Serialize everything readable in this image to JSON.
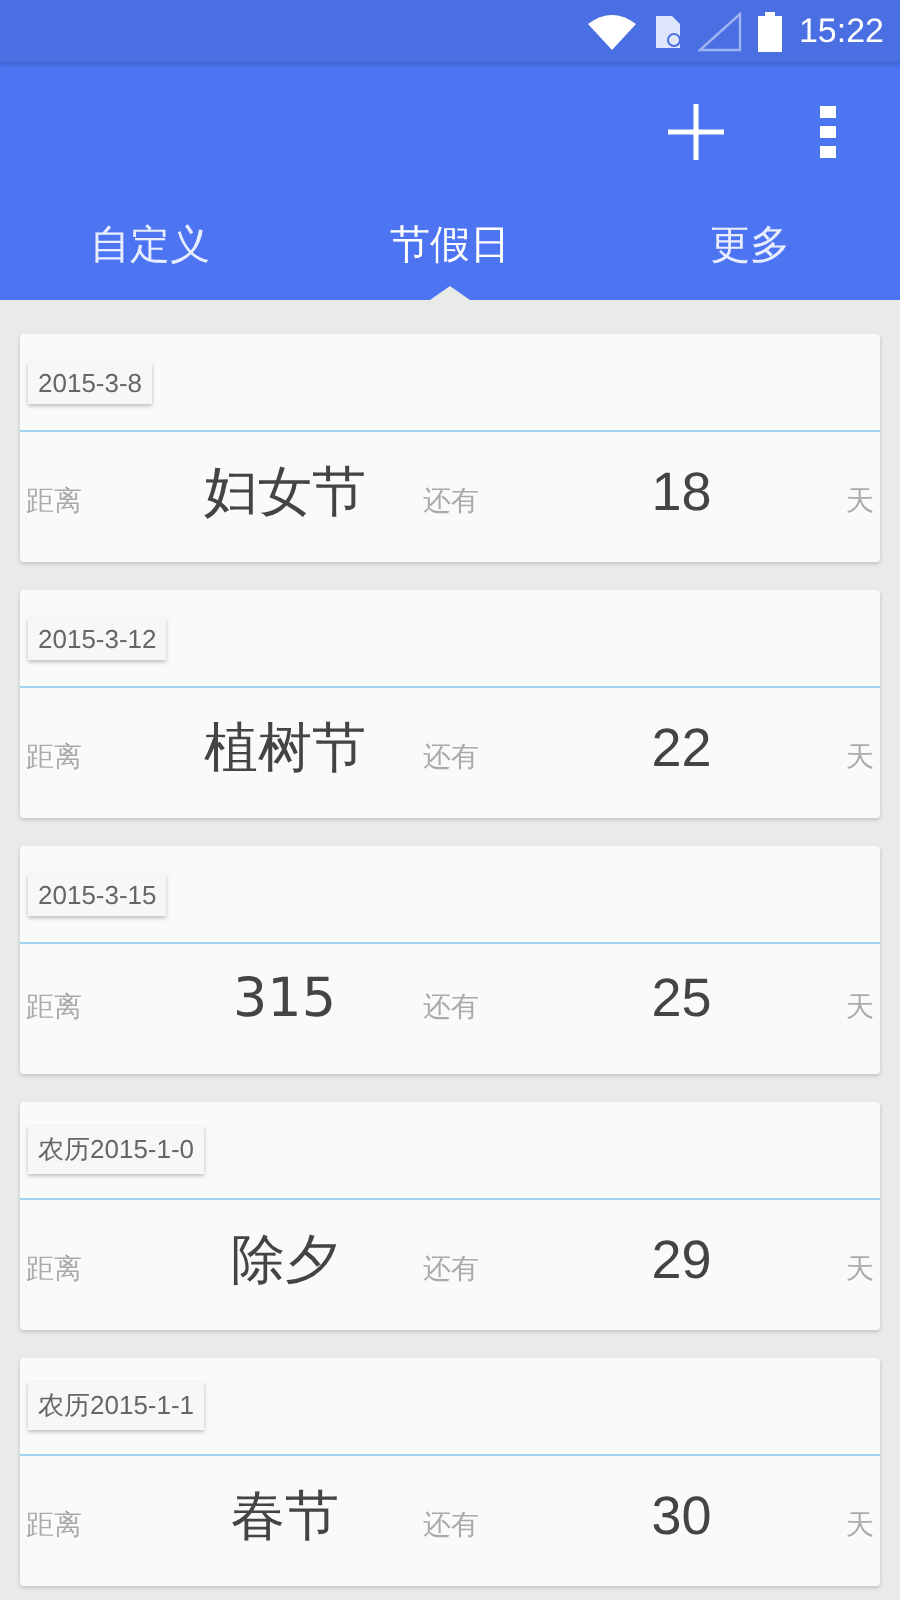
{
  "status_bar": {
    "time": "15:22"
  },
  "tabs": [
    {
      "label": "自定义",
      "selected": false
    },
    {
      "label": "节假日",
      "selected": true
    },
    {
      "label": "更多",
      "selected": false
    }
  ],
  "events": [
    {
      "date": "2015-3-8",
      "prefix": "距离",
      "name": "妇女节",
      "middle": "还有",
      "days": "18",
      "unit": "天"
    },
    {
      "date": "2015-3-12",
      "prefix": "距离",
      "name": "植树节",
      "middle": "还有",
      "days": "22",
      "unit": "天"
    },
    {
      "date": "2015-3-15",
      "prefix": "距离",
      "name": "315",
      "middle": "还有",
      "days": "25",
      "unit": "天"
    },
    {
      "date": "农历2015-1-0",
      "prefix": "距离",
      "name": "除夕",
      "middle": "还有",
      "days": "29",
      "unit": "天"
    },
    {
      "date": "农历2015-1-1",
      "prefix": "距离",
      "name": "春节",
      "middle": "还有",
      "days": "30",
      "unit": "天"
    }
  ]
}
